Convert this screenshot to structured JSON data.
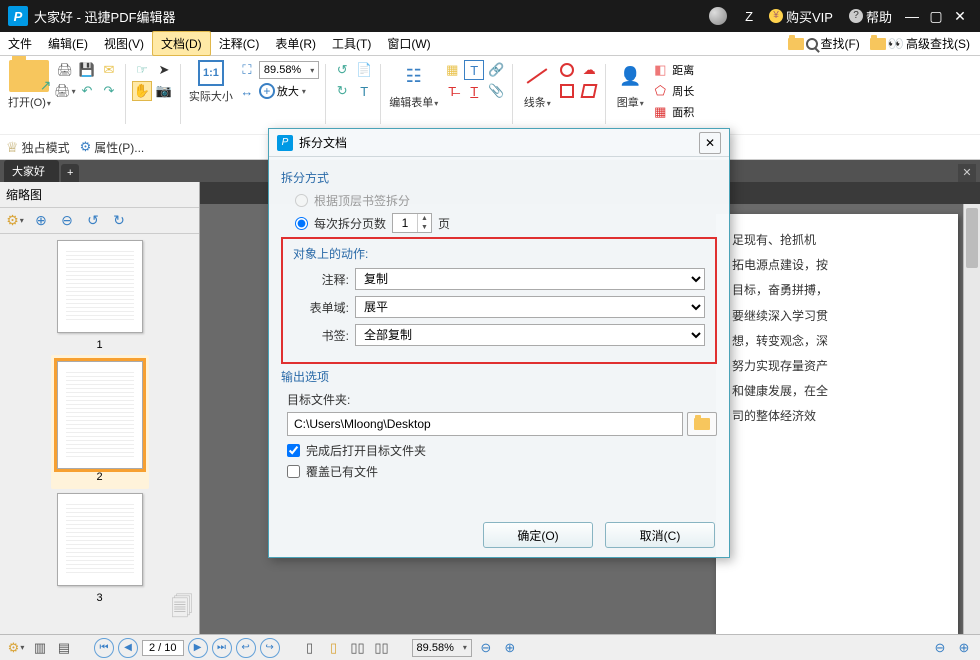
{
  "titlebar": {
    "title": "大家好 - 迅捷PDF编辑器",
    "user": "Z",
    "vip": "购买VIP",
    "help": "帮助"
  },
  "menubar": {
    "items": [
      "文件",
      "编辑(E)",
      "视图(V)",
      "文档(D)",
      "注释(C)",
      "表单(R)",
      "工具(T)",
      "窗口(W)"
    ],
    "active_index": 3,
    "search": "查找(F)",
    "adv_search": "高级查找(S)"
  },
  "ribbon": {
    "open": "打开(O)",
    "actual_size": "实际大小",
    "zoom_value": "89.58%",
    "enlarge": "放大",
    "edit_form": "编辑表单",
    "lines": "线条",
    "stamp": "图章",
    "distance": "距离",
    "perimeter": "周长",
    "area": "面积"
  },
  "subbar": {
    "exclusive": "独占模式",
    "properties": "属性(P)..."
  },
  "tabs": {
    "tab1": "大家好"
  },
  "sidebar": {
    "title": "缩略图",
    "thumbs": [
      {
        "n": "1"
      },
      {
        "n": "2"
      },
      {
        "n": "3"
      }
    ],
    "selected_index": 1
  },
  "page_text": [
    "足现有、抢抓机",
    "拓电源点建设，按",
    "目标，奋勇拼搏，",
    "",
    "要继续深入学习贯",
    "想，转变观念，深",
    "努力实现存量资产",
    "和健康发展，在全",
    "司的整体经济效"
  ],
  "dialog": {
    "title": "拆分文档",
    "sec_method": "拆分方式",
    "radio_top_bookmark": "根据顶层书签拆分",
    "radio_per_pages": "每次拆分页数",
    "pages_value": "1",
    "pages_suffix": "页",
    "sec_actions": "对象上的动作:",
    "label_comment": "注释:",
    "label_form": "表单域:",
    "label_bookmark": "书签:",
    "value_comment": "复制",
    "value_form": "展平",
    "value_bookmark": "全部复制",
    "sec_output": "输出选项",
    "label_dest": "目标文件夹:",
    "dest_path": "C:\\Users\\Mloong\\Desktop",
    "cb_open_after": "完成后打开目标文件夹",
    "cb_overwrite": "覆盖已有文件",
    "btn_ok": "确定(O)",
    "btn_cancel": "取消(C)"
  },
  "status": {
    "page_cur": "2",
    "page_total": "10",
    "zoom": "89.58%"
  }
}
